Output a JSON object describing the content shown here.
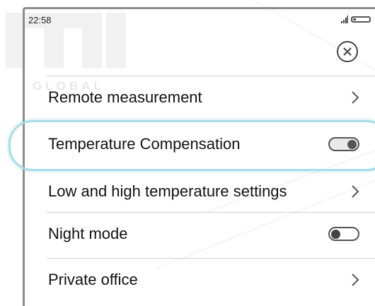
{
  "status_bar": {
    "time": "22:58",
    "icons": [
      "signal-icon",
      "battery-icon"
    ]
  },
  "header": {
    "close_icon": "close-icon"
  },
  "watermark": {
    "text": "GLOBAL"
  },
  "menu": {
    "items": [
      {
        "label": "Remote measurement",
        "control": "chevron-right-icon"
      },
      {
        "label": "Temperature Compensation",
        "control": "toggle",
        "state": "on"
      },
      {
        "label": "Low and high temperature settings",
        "control": "chevron-right-icon"
      },
      {
        "label": "Night mode",
        "control": "toggle",
        "state": "off"
      },
      {
        "label": "Private office",
        "control": "chevron-right-icon"
      }
    ]
  },
  "highlight_color": "#a7dde8"
}
